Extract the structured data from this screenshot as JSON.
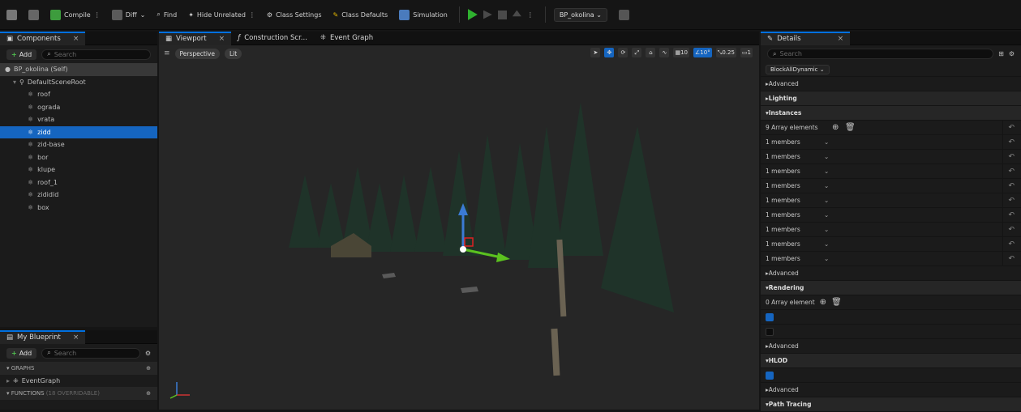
{
  "toolbar": {
    "compile": "Compile",
    "diff": "Diff",
    "find": "Find",
    "hide_unrelated": "Hide Unrelated",
    "class_settings": "Class Settings",
    "class_defaults": "Class Defaults",
    "simulation": "Simulation",
    "debug_object": "BP_okolina"
  },
  "components": {
    "tab": "Components",
    "add": "Add",
    "search_placeholder": "Search",
    "self": "BP_okolina (Self)",
    "root": "DefaultSceneRoot",
    "items": [
      "roof",
      "ograda",
      "vrata",
      "zidd",
      "zid-base",
      "bor",
      "klupe",
      "roof_1",
      "zididid",
      "box"
    ],
    "selected": "zidd"
  },
  "blueprint": {
    "tab": "My Blueprint",
    "add": "Add",
    "search_placeholder": "Search",
    "graphs_label": "GRAPHS",
    "event_graph": "EventGraph",
    "functions_label": "FUNCTIONS",
    "functions_count": "(18 OVERRIDABLE)"
  },
  "editor_tabs": [
    "Viewport",
    "Construction Scr...",
    "Event Graph"
  ],
  "viewport": {
    "perspective": "Perspective",
    "lit": "Lit",
    "grid_snap": "10",
    "rot_snap": "10°",
    "scale_snap": "0.25",
    "cam_speed": "1"
  },
  "details": {
    "tab": "Details",
    "search_placeholder": "Search",
    "collision_preset": "BlockAllDynamic",
    "advanced": "Advanced",
    "lighting": "Lighting",
    "instances": "Instances",
    "instances_count": "9 Array elements",
    "member_label": "1 members",
    "member_count": 9,
    "rendering": "Rendering",
    "rendering_count": "0 Array element",
    "hlod": "HLOD",
    "path_tracing": "Path Tracing"
  },
  "colors": {
    "accent": "#0070e0",
    "selected": "#1565c0",
    "play": "#2fb12f"
  }
}
